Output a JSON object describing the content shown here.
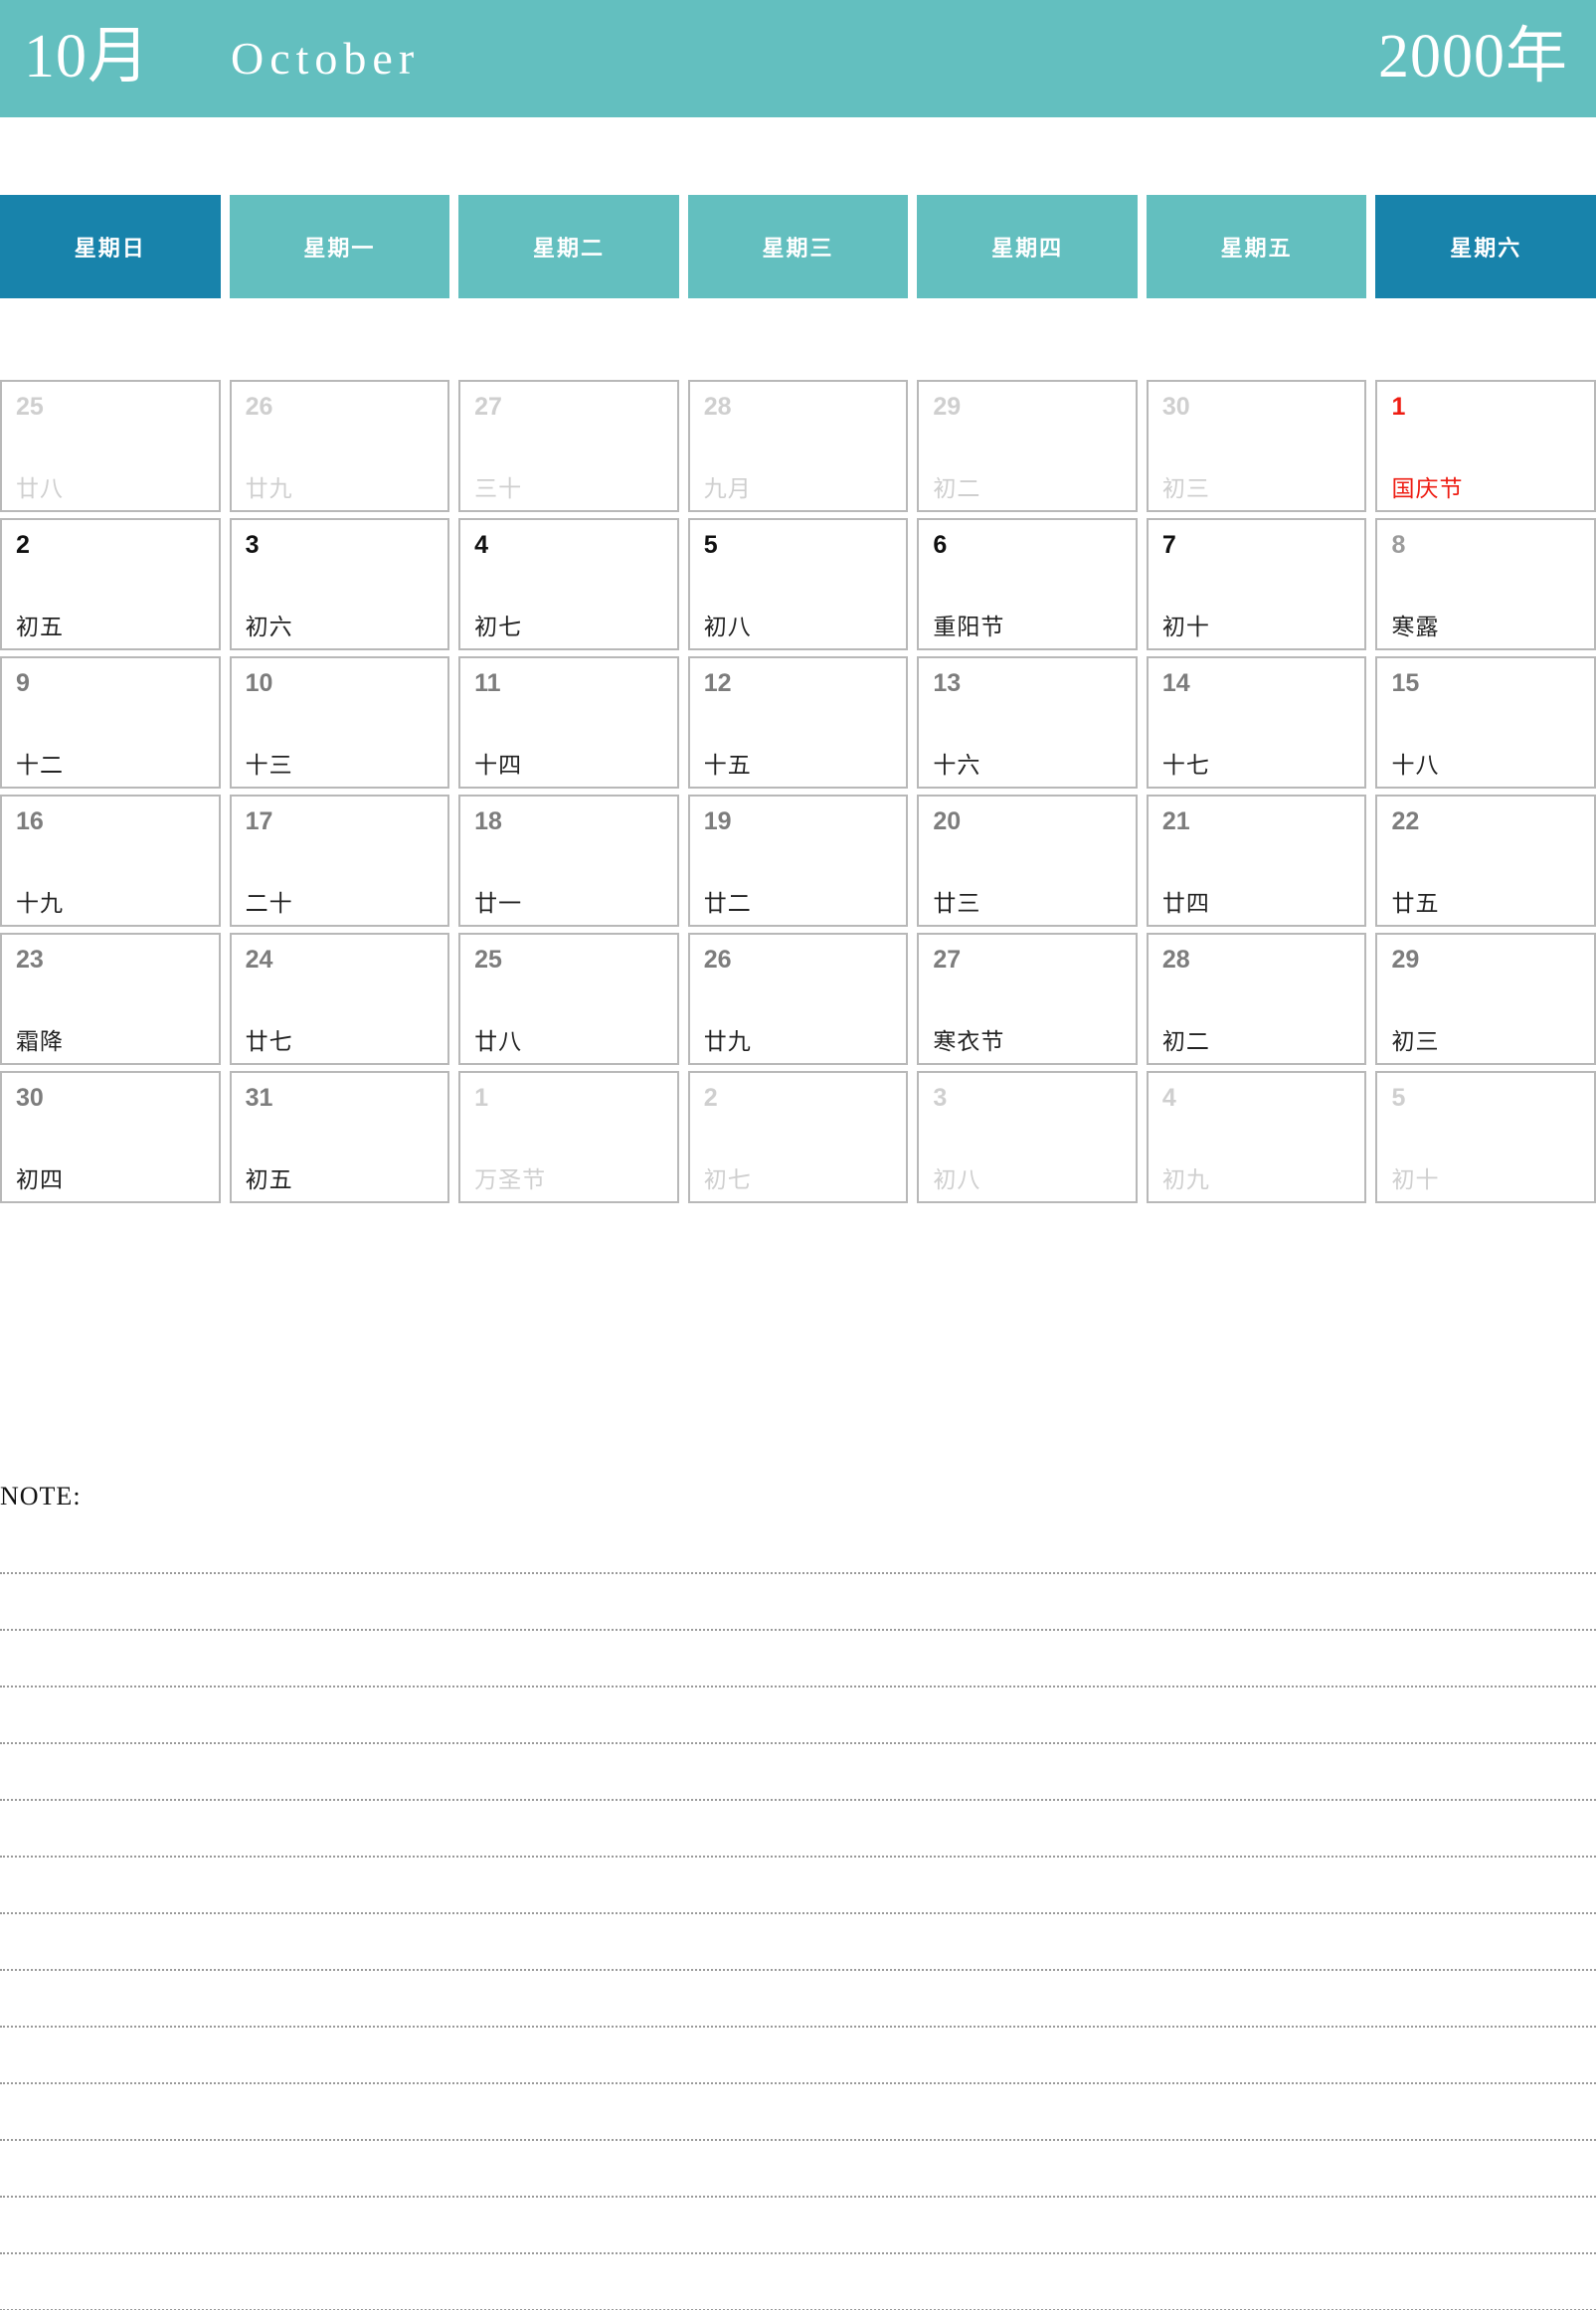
{
  "header": {
    "month_cn": "10月",
    "month_en": "October",
    "year": "2000年",
    "bg_color": "#63bfbf",
    "text_color": "#ffffff"
  },
  "weekdays": [
    {
      "label": "星期日",
      "weekend": true,
      "color": "#1883ab"
    },
    {
      "label": "星期一",
      "weekend": false,
      "color": "#63bfbf"
    },
    {
      "label": "星期二",
      "weekend": false,
      "color": "#63bfbf"
    },
    {
      "label": "星期三",
      "weekend": false,
      "color": "#63bfbf"
    },
    {
      "label": "星期四",
      "weekend": false,
      "color": "#63bfbf"
    },
    {
      "label": "星期五",
      "weekend": false,
      "color": "#63bfbf"
    },
    {
      "label": "星期六",
      "weekend": true,
      "color": "#1883ab"
    }
  ],
  "colors": {
    "accent_light": "#63bfbf",
    "accent_dark": "#1883ab",
    "holiday_red": "#ee1c12",
    "cell_border": "#b8b8b8",
    "other_month_text": "#cfcfcf",
    "mid_text": "#7d7d7d",
    "body_text": "#222222"
  },
  "weeks": [
    [
      {
        "day": "25",
        "lunar": "廿八",
        "tone": "other"
      },
      {
        "day": "26",
        "lunar": "廿九",
        "tone": "other"
      },
      {
        "day": "27",
        "lunar": "三十",
        "tone": "other"
      },
      {
        "day": "28",
        "lunar": "九月",
        "tone": "other"
      },
      {
        "day": "29",
        "lunar": "初二",
        "tone": "other"
      },
      {
        "day": "30",
        "lunar": "初三",
        "tone": "other"
      },
      {
        "day": "1",
        "lunar": "国庆节",
        "tone": "holiday"
      }
    ],
    [
      {
        "day": "2",
        "lunar": "初五",
        "tone": "normal"
      },
      {
        "day": "3",
        "lunar": "初六",
        "tone": "normal"
      },
      {
        "day": "4",
        "lunar": "初七",
        "tone": "normal"
      },
      {
        "day": "5",
        "lunar": "初八",
        "tone": "normal"
      },
      {
        "day": "6",
        "lunar": "重阳节",
        "tone": "normal"
      },
      {
        "day": "7",
        "lunar": "初十",
        "tone": "normal"
      },
      {
        "day": "8",
        "lunar": "寒露",
        "tone": "dim"
      }
    ],
    [
      {
        "day": "9",
        "lunar": "十二",
        "tone": "mid"
      },
      {
        "day": "10",
        "lunar": "十三",
        "tone": "mid"
      },
      {
        "day": "11",
        "lunar": "十四",
        "tone": "mid"
      },
      {
        "day": "12",
        "lunar": "十五",
        "tone": "mid"
      },
      {
        "day": "13",
        "lunar": "十六",
        "tone": "mid"
      },
      {
        "day": "14",
        "lunar": "十七",
        "tone": "mid"
      },
      {
        "day": "15",
        "lunar": "十八",
        "tone": "mid"
      }
    ],
    [
      {
        "day": "16",
        "lunar": "十九",
        "tone": "mid"
      },
      {
        "day": "17",
        "lunar": "二十",
        "tone": "mid"
      },
      {
        "day": "18",
        "lunar": "廿一",
        "tone": "mid"
      },
      {
        "day": "19",
        "lunar": "廿二",
        "tone": "mid"
      },
      {
        "day": "20",
        "lunar": "廿三",
        "tone": "mid"
      },
      {
        "day": "21",
        "lunar": "廿四",
        "tone": "mid"
      },
      {
        "day": "22",
        "lunar": "廿五",
        "tone": "mid"
      }
    ],
    [
      {
        "day": "23",
        "lunar": "霜降",
        "tone": "mid"
      },
      {
        "day": "24",
        "lunar": "廿七",
        "tone": "mid"
      },
      {
        "day": "25",
        "lunar": "廿八",
        "tone": "mid"
      },
      {
        "day": "26",
        "lunar": "廿九",
        "tone": "mid"
      },
      {
        "day": "27",
        "lunar": "寒衣节",
        "tone": "mid"
      },
      {
        "day": "28",
        "lunar": "初二",
        "tone": "mid"
      },
      {
        "day": "29",
        "lunar": "初三",
        "tone": "mid"
      }
    ],
    [
      {
        "day": "30",
        "lunar": "初四",
        "tone": "mid"
      },
      {
        "day": "31",
        "lunar": "初五",
        "tone": "mid"
      },
      {
        "day": "1",
        "lunar": "万圣节",
        "tone": "other"
      },
      {
        "day": "2",
        "lunar": "初七",
        "tone": "other"
      },
      {
        "day": "3",
        "lunar": "初八",
        "tone": "other"
      },
      {
        "day": "4",
        "lunar": "初九",
        "tone": "other"
      },
      {
        "day": "5",
        "lunar": "初十",
        "tone": "other"
      }
    ]
  ],
  "note": {
    "label": "NOTE:",
    "line_count": 14
  }
}
